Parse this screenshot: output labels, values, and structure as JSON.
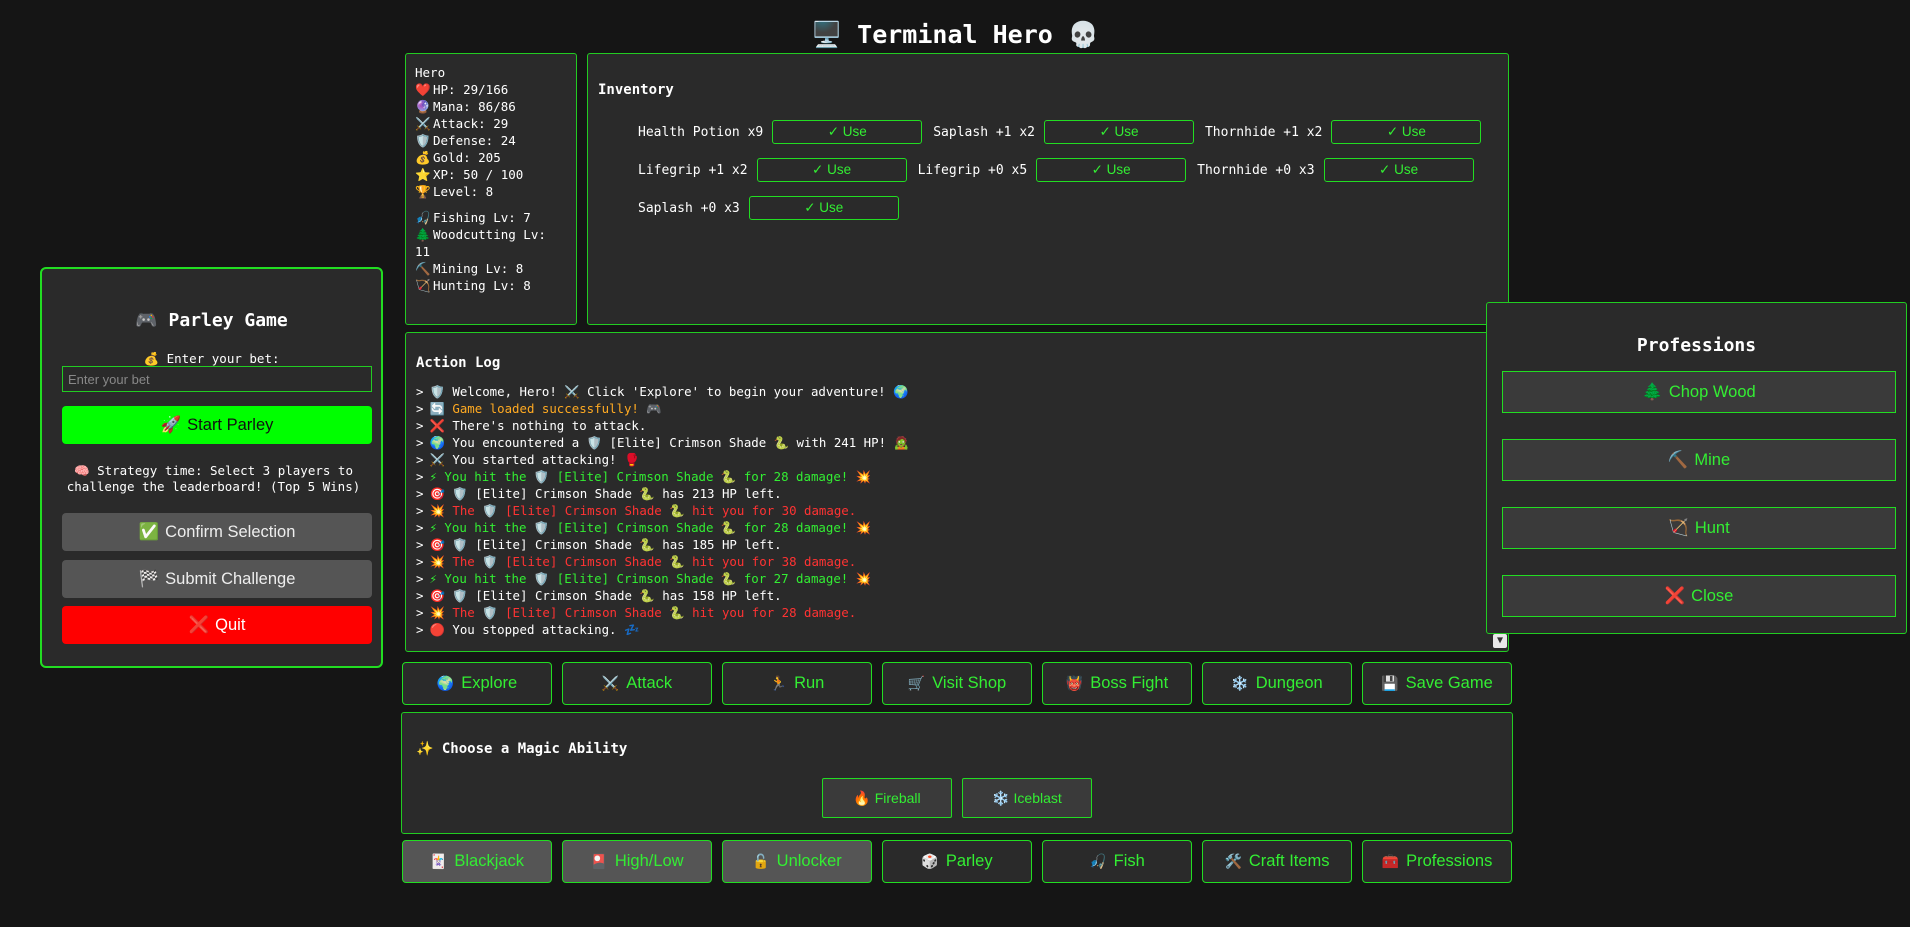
{
  "header": {
    "icon": "monitor-icon",
    "title": "Terminal Hero",
    "skull": "skull-icon"
  },
  "stats": {
    "name": "Hero",
    "hp": "HP: 29/166",
    "mana": "Mana: 86/86",
    "attack": "Attack: 29",
    "defense": "Defense: 24",
    "gold": "Gold: 205",
    "xp": "XP: 50 / 100",
    "level": "Level: 8",
    "fishing": "Fishing Lv: 7",
    "woodcutting": "Woodcutting Lv: 11",
    "mining": "Mining Lv: 8",
    "hunting": "Hunting Lv: 8"
  },
  "inventory": {
    "title": "Inventory",
    "use_label": "✓ Use",
    "items": [
      "Health Potion x9",
      "Saplash +1 x2",
      "Thornhide +1 x2",
      "Lifegrip +1 x2",
      "Lifegrip +0 x5",
      "Thornhide +0 x3",
      "Saplash +0 x3"
    ]
  },
  "log": {
    "title": "Action Log",
    "prefix": ">",
    "lines": [
      {
        "icon": "🛡️",
        "text": "Welcome, Hero! ⚔️ Click 'Explore' to begin your adventure! 🌍",
        "color": "white"
      },
      {
        "icon": "🔄",
        "text": "Game loaded successfully! 🎮",
        "color": "orange"
      },
      {
        "icon": "❌",
        "text": "There's nothing to attack.",
        "color": "white"
      },
      {
        "icon": "🌍",
        "text": "You encountered a 🛡️ [Elite] Crimson Shade 🐍 with 241 HP! 🧟",
        "color": "white"
      },
      {
        "icon": "⚔️",
        "text": "You started attacking! 🥊",
        "color": "white"
      },
      {
        "icon": "⚡",
        "text": "You hit the 🛡️ [Elite] Crimson Shade 🐍 for 28 damage! 💥",
        "color": "green"
      },
      {
        "icon": "🎯",
        "text": "🛡️ [Elite] Crimson Shade 🐍 has 213 HP left.",
        "color": "white"
      },
      {
        "icon": "💥",
        "text": "The 🛡️ [Elite] Crimson Shade 🐍 hit you for 30 damage.",
        "color": "red"
      },
      {
        "icon": "⚡",
        "text": "You hit the 🛡️ [Elite] Crimson Shade 🐍 for 28 damage! 💥",
        "color": "green"
      },
      {
        "icon": "🎯",
        "text": "🛡️ [Elite] Crimson Shade 🐍 has 185 HP left.",
        "color": "white"
      },
      {
        "icon": "💥",
        "text": "The 🛡️ [Elite] Crimson Shade 🐍 hit you for 38 damage.",
        "color": "red"
      },
      {
        "icon": "⚡",
        "text": "You hit the 🛡️ [Elite] Crimson Shade 🐍 for 27 damage! 💥",
        "color": "green"
      },
      {
        "icon": "🎯",
        "text": "🛡️ [Elite] Crimson Shade 🐍 has 158 HP left.",
        "color": "white"
      },
      {
        "icon": "💥",
        "text": "The 🛡️ [Elite] Crimson Shade 🐍 hit you for 28 damage.",
        "color": "red"
      },
      {
        "icon": "🔴",
        "text": "You stopped attacking. 💤",
        "color": "white"
      }
    ]
  },
  "actions": {
    "explore": "Explore",
    "attack": "Attack",
    "run": "Run",
    "visit_shop": "Visit Shop",
    "boss_fight": "Boss Fight",
    "dungeon": "Dungeon",
    "save_game": "Save Game"
  },
  "magic": {
    "title": "Choose a Magic Ability",
    "fireball": "Fireball",
    "iceblast": "Iceblast"
  },
  "games": {
    "blackjack": "Blackjack",
    "highlow": "High/Low",
    "unlocker": "Unlocker",
    "parley": "Parley",
    "fish": "Fish",
    "craft_items": "Craft Items",
    "professions": "Professions"
  },
  "parley": {
    "title": "Parley Game",
    "bet_label": "Enter your bet:",
    "bet_placeholder": "Enter your bet",
    "start": "Start Parley",
    "strategy": "Strategy time: Select 3 players to challenge the leaderboard! (Top 5 Wins)",
    "confirm": "Confirm Selection",
    "submit": "Submit Challenge",
    "quit": "Quit"
  },
  "professions": {
    "title": "Professions",
    "chop_wood": "Chop Wood",
    "mine": "Mine",
    "hunt": "Hunt",
    "close": "Close"
  },
  "colors": {
    "accent": "#22dd22",
    "text_green": "#33ee33",
    "danger": "#ff0000",
    "start": "#00ff00",
    "bg": "#151515",
    "panel": "#2a2a2a"
  }
}
